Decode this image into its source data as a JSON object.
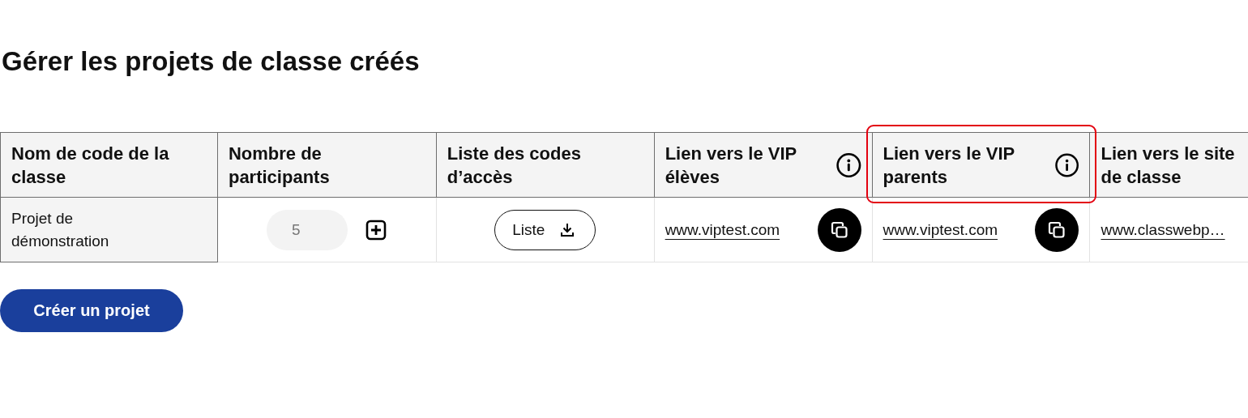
{
  "title": "Gérer les projets de classe créés",
  "table": {
    "columns": [
      {
        "label": "Nom de code de la classe",
        "info": false,
        "highlighted": false
      },
      {
        "label": "Nombre de participants",
        "info": false,
        "highlighted": false
      },
      {
        "label": "Liste des codes d’accès",
        "info": false,
        "highlighted": false
      },
      {
        "label": "Lien vers le VIP élèves",
        "info": true,
        "highlighted": false
      },
      {
        "label": "Lien vers le VIP parents",
        "info": true,
        "highlighted": true
      },
      {
        "label": "Lien vers le site de classe",
        "info": false,
        "highlighted": false
      }
    ],
    "rows": [
      [
        {
          "kind": "text",
          "text": "Projet de démonstration"
        },
        {
          "kind": "stepper",
          "value": "5"
        },
        {
          "kind": "download",
          "label": "Liste"
        },
        {
          "kind": "link-copy",
          "text": "www.viptest.com"
        },
        {
          "kind": "link-copy",
          "text": "www.viptest.com"
        },
        {
          "kind": "link",
          "text": "www.classwebp…"
        }
      ]
    ]
  },
  "create_button": "Créer un projet"
}
